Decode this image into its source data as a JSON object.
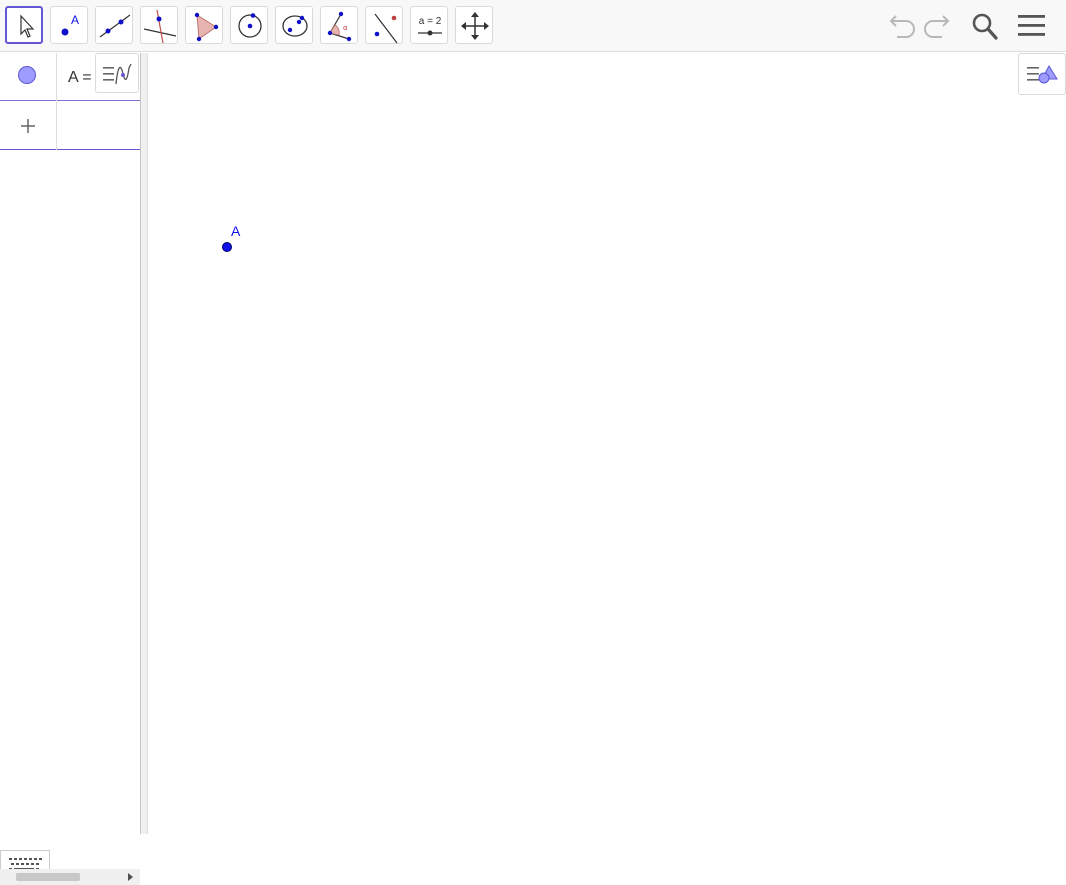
{
  "toolbar": {
    "tools": [
      {
        "name": "move",
        "icon": "move-arrow-icon"
      },
      {
        "name": "point",
        "icon": "point-icon",
        "label": "A"
      },
      {
        "name": "line",
        "icon": "line-icon"
      },
      {
        "name": "perpendicular-line",
        "icon": "perpendicular-line-icon"
      },
      {
        "name": "polygon",
        "icon": "polygon-icon"
      },
      {
        "name": "circle-center-point",
        "icon": "circle-icon"
      },
      {
        "name": "ellipse",
        "icon": "ellipse-icon"
      },
      {
        "name": "angle",
        "icon": "angle-icon"
      },
      {
        "name": "reflect",
        "icon": "reflect-icon"
      },
      {
        "name": "slider",
        "icon": "slider-icon",
        "label": "a = 2"
      },
      {
        "name": "move-graphics-view",
        "icon": "move-view-icon"
      }
    ],
    "right_buttons": [
      "undo-icon",
      "redo-icon",
      "search-icon",
      "menu-icon"
    ]
  },
  "algebra_view": {
    "rows": [
      {
        "text": "A ="
      }
    ],
    "input_row_icon": "plus-icon"
  },
  "graphics_view": {
    "points": [
      {
        "label": "A",
        "color": "#1010e8"
      }
    ]
  },
  "colors": {
    "accent": "#6557d2",
    "point": "#1010e8",
    "visibility_dot": "#9e9cff",
    "toolbar_bg": "#f8f8f8"
  }
}
